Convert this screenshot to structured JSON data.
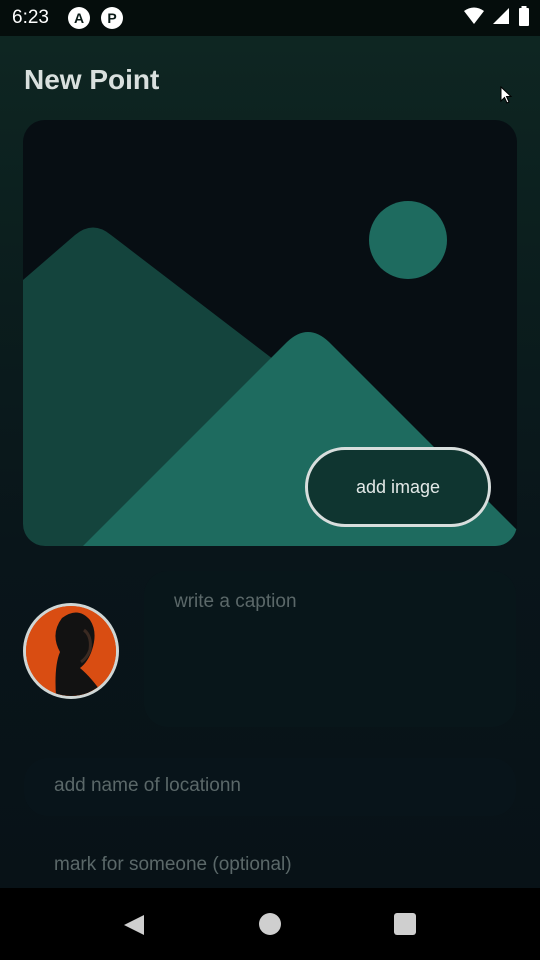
{
  "status_bar": {
    "time": "6:23",
    "app_icons": [
      "A",
      "P"
    ]
  },
  "page": {
    "title": "New Point"
  },
  "image_picker": {
    "button_label": "add image",
    "placeholder_icon": "image-placeholder-icon"
  },
  "caption": {
    "placeholder": "write a caption"
  },
  "location": {
    "placeholder": "add name of locationn"
  },
  "mark": {
    "placeholder": "mark for someone (optional)"
  },
  "colors": {
    "accent": "#1e6b5f",
    "mountain_back": "#14443d",
    "card_bg": "#070e13",
    "avatar_bg": "#d94d12"
  }
}
